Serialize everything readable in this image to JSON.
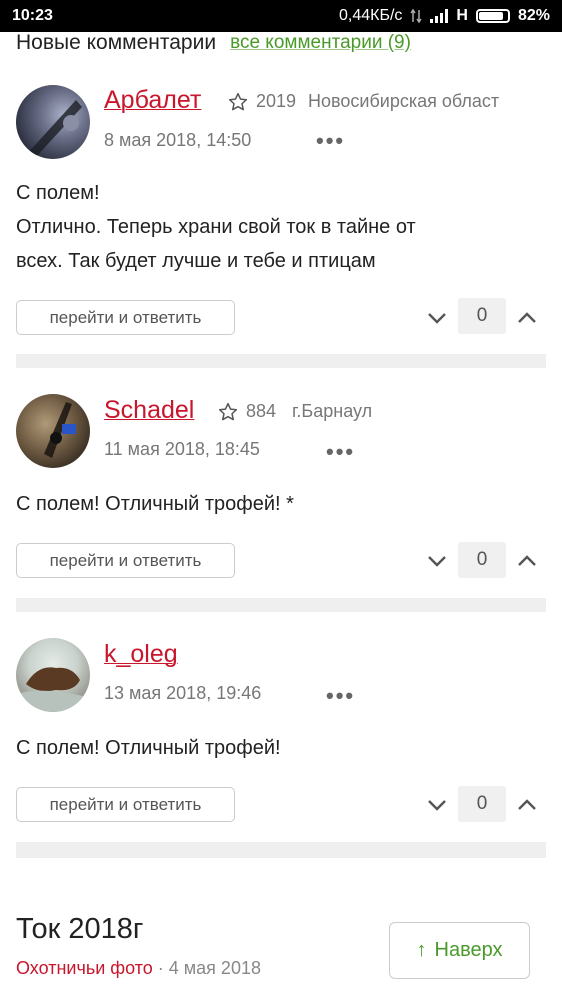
{
  "status": {
    "time": "10:23",
    "speed": "0,44КБ/с",
    "network": "H",
    "battery": "82%"
  },
  "header": {
    "title": "Новые комментарии",
    "all_link": "все комментарии (9)"
  },
  "comments": [
    {
      "author": "Арбалет",
      "rating": "2019",
      "location": "Новосибирская област",
      "date": "8 мая 2018, 14:50",
      "more": "•••",
      "text_lines": [
        "С полем!",
        "Отлично. Теперь храни свой ток в тайне от",
        "всех. Так будет лучше и тебе и птицам"
      ],
      "reply_label": "перейти и ответить",
      "votes": "0"
    },
    {
      "author": "Schadel",
      "rating": "884",
      "location": "г.Барнаул",
      "date": "11 мая 2018, 18:45",
      "more": "•••",
      "text_lines": [
        "С полем! Отличный трофей! *"
      ],
      "reply_label": "перейти и ответить",
      "votes": "0"
    },
    {
      "author": "k_oleg",
      "rating": "",
      "location": "",
      "date": "13 мая 2018, 19:46",
      "more": "•••",
      "text_lines": [
        "С полем! Отличный трофей!"
      ],
      "reply_label": "перейти и ответить",
      "votes": "0"
    }
  ],
  "post": {
    "title": "Ток 2018г",
    "category": "Охотничьи фото",
    "separator": "·",
    "date": "4 мая 2018"
  },
  "to_top": {
    "arrow": "↑",
    "label": "Наверх"
  },
  "colors": {
    "accent_red": "#c8162c",
    "accent_green": "#4a9a2a"
  }
}
